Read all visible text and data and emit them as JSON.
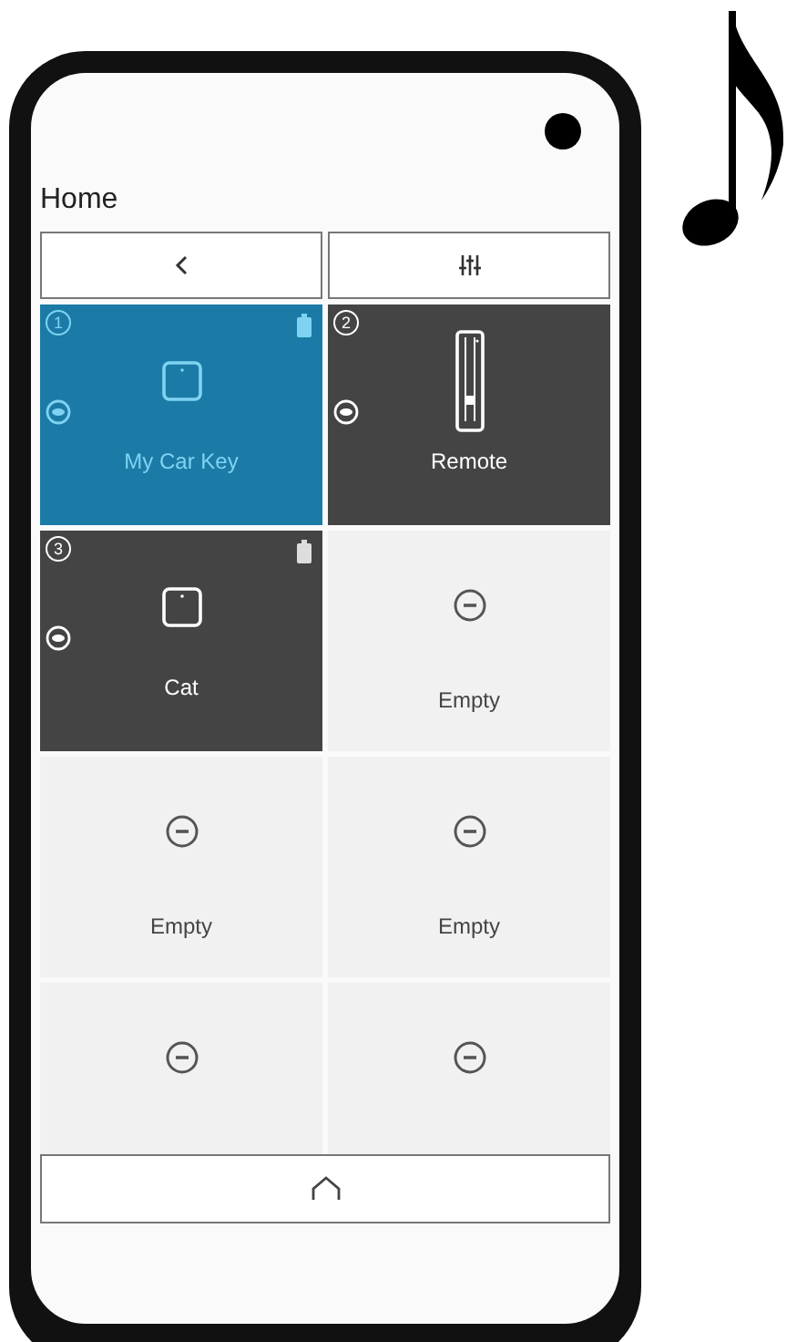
{
  "screen": {
    "title": "Home"
  },
  "tiles": [
    {
      "kind": "tag",
      "number": "1",
      "label": "My Car Key",
      "selected": true,
      "battery": true
    },
    {
      "kind": "remote",
      "number": "2",
      "label": "Remote",
      "selected": false,
      "battery": false
    },
    {
      "kind": "tag",
      "number": "3",
      "label": "Cat",
      "selected": false,
      "battery": true
    },
    {
      "kind": "empty",
      "label": "Empty"
    },
    {
      "kind": "empty",
      "label": "Empty"
    },
    {
      "kind": "empty",
      "label": "Empty"
    },
    {
      "kind": "empty"
    },
    {
      "kind": "empty"
    }
  ]
}
